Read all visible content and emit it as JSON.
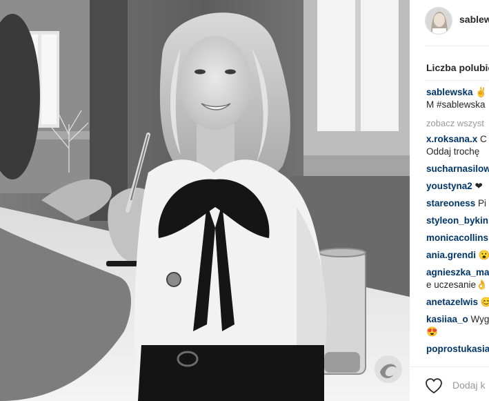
{
  "post": {
    "username": "sablewska",
    "likes_label": "Liczba polubie",
    "caption": {
      "user": "sablewska",
      "text_line1": " ✌ L",
      "text_line2": "M #sablewska"
    },
    "view_all": "zobacz wszyst",
    "comments": [
      {
        "user": "x.roksana.x",
        "text": " C",
        "text2": "Oddaj trochę"
      },
      {
        "user": "sucharnasilow",
        "text": ""
      },
      {
        "user": "youstyna2",
        "text": " ❤"
      },
      {
        "user": "stareoness",
        "text": " Pi"
      },
      {
        "user": "styleon_bykin",
        "text": ""
      },
      {
        "user": "monicacollins",
        "text": ""
      },
      {
        "user": "ania.grendi",
        "text": " 😮"
      },
      {
        "user": "agnieszka_ma",
        "text": "",
        "text2": "e uczesanie👌"
      },
      {
        "user": "anetazelwis",
        "text": " 😊"
      },
      {
        "user": "kasiiaa_o",
        "text": " Wyg",
        "text2": "😍"
      },
      {
        "user": "poprostukasia",
        "text": ""
      }
    ],
    "add_comment_placeholder": "Dodaj k"
  },
  "colors": {
    "username": "#003569",
    "text": "#262626",
    "muted": "#999999"
  }
}
